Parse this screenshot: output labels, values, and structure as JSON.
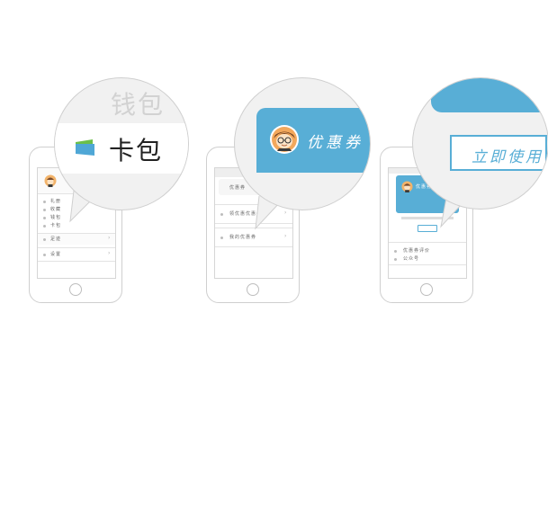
{
  "colors": {
    "accent": "#58aed6",
    "phone_border": "#cfcfcf",
    "bubble_bg": "#f1f1f1",
    "text": "#333333"
  },
  "panel1": {
    "bubble_faded": "钱包",
    "bubble_main": "卡包",
    "menu_items": [
      "礼册",
      "收藏",
      "钱包",
      "卡包"
    ],
    "row_main": "足迹",
    "row_settings": "设置",
    "icons": [
      "avatar-icon",
      "wallet-card-icon"
    ]
  },
  "panel2": {
    "bubble_banner": "优惠券",
    "screen_header": "优惠券",
    "row1": "领优惠优惠券",
    "row2": "我的优惠券"
  },
  "panel3": {
    "bubble_button": "立即使用",
    "screen_banner": "优惠券",
    "list_items": [
      "优惠券评价",
      "公众号"
    ]
  }
}
